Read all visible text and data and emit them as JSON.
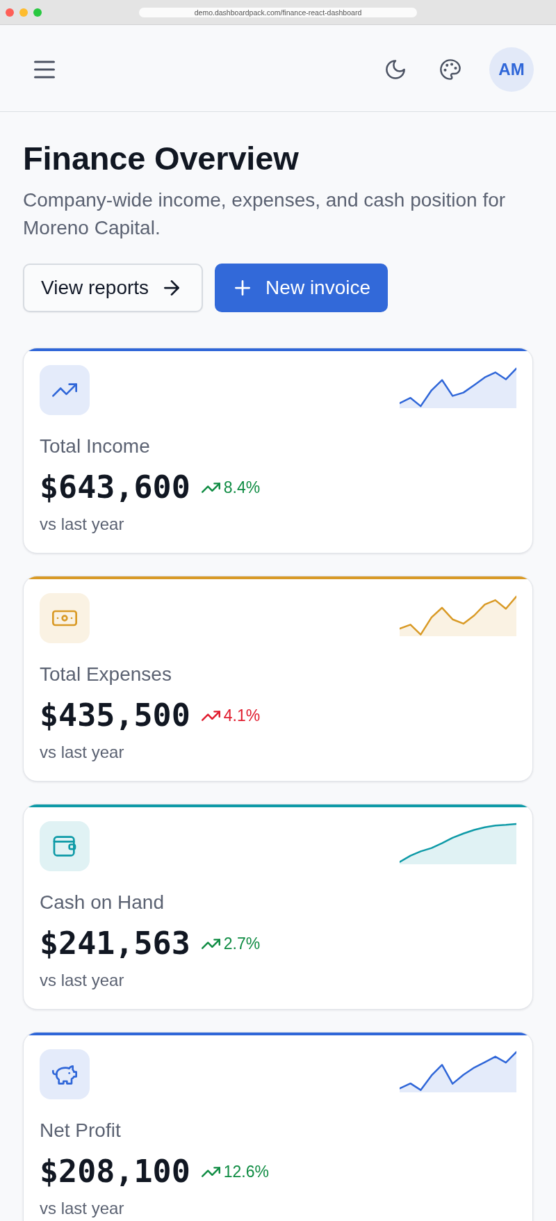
{
  "browser": {
    "url": "demo.dashboardpack.com/finance-react-dashboard"
  },
  "header": {
    "avatar": "AM"
  },
  "page": {
    "title": "Finance Overview",
    "subtitle": "Company-wide income, expenses, and cash position for Moreno Capital.",
    "actions": [
      {
        "label": "View reports",
        "kind": "secondary"
      },
      {
        "label": "New invoice",
        "kind": "primary"
      }
    ]
  },
  "metrics": [
    {
      "label": "Total Income",
      "value": "$643,600",
      "change": {
        "text": "8.4%",
        "color": "#0f8c43"
      },
      "note": "vs last year",
      "color": "#2f66d8"
    },
    {
      "label": "Total Expenses",
      "value": "$435,500",
      "change": {
        "text": "4.1%",
        "color": "#e01b2d"
      },
      "note": "vs last year",
      "color": "#d99a26"
    },
    {
      "label": "Cash on Hand",
      "value": "$241,563",
      "change": {
        "text": "2.7%",
        "color": "#0f8c43"
      },
      "note": "vs last year",
      "color": "#0e9aa7"
    },
    {
      "label": "Net Profit",
      "value": "$208,100",
      "change": {
        "text": "12.6%",
        "color": "#0f8c43"
      },
      "note": "vs last year",
      "color": "#2f66d8"
    }
  ]
}
